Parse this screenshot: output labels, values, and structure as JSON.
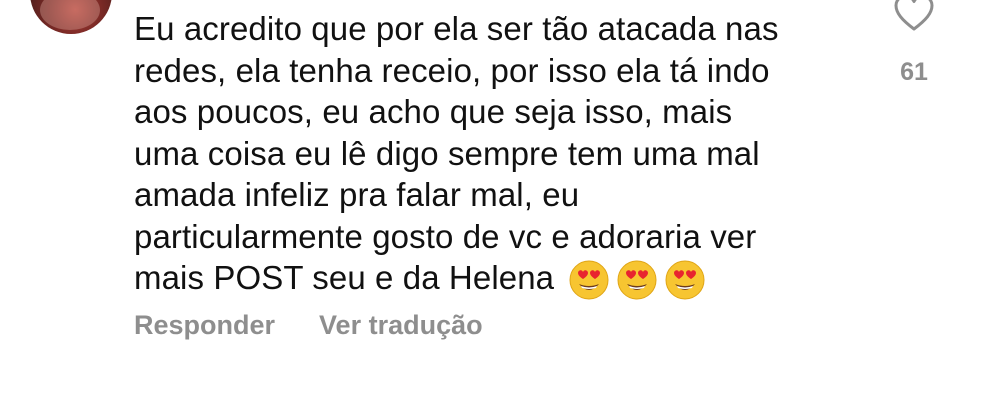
{
  "comment": {
    "lines": [
      "Eu acredito que por ela ser tão atacada nas",
      "redes, ela tenha receio, por isso ela tá indo",
      "aos poucos, eu acho que seja isso, mais",
      "uma coisa eu lê digo sempre tem uma mal",
      "amada infeliz pra falar mal, eu",
      "particularmente gosto de vc e adoraria ver",
      "mais POST seu e da Helena"
    ],
    "emojis": [
      "smiling-face-with-heart-eyes",
      "smiling-face-with-heart-eyes",
      "smiling-face-with-heart-eyes"
    ]
  },
  "actions": {
    "reply_label": "Responder",
    "translate_label": "Ver tradução"
  },
  "like": {
    "count": "61",
    "icon": "heart-outline-icon"
  },
  "colors": {
    "text": "#111111",
    "muted": "#8e8e8e",
    "background": "#ffffff"
  }
}
